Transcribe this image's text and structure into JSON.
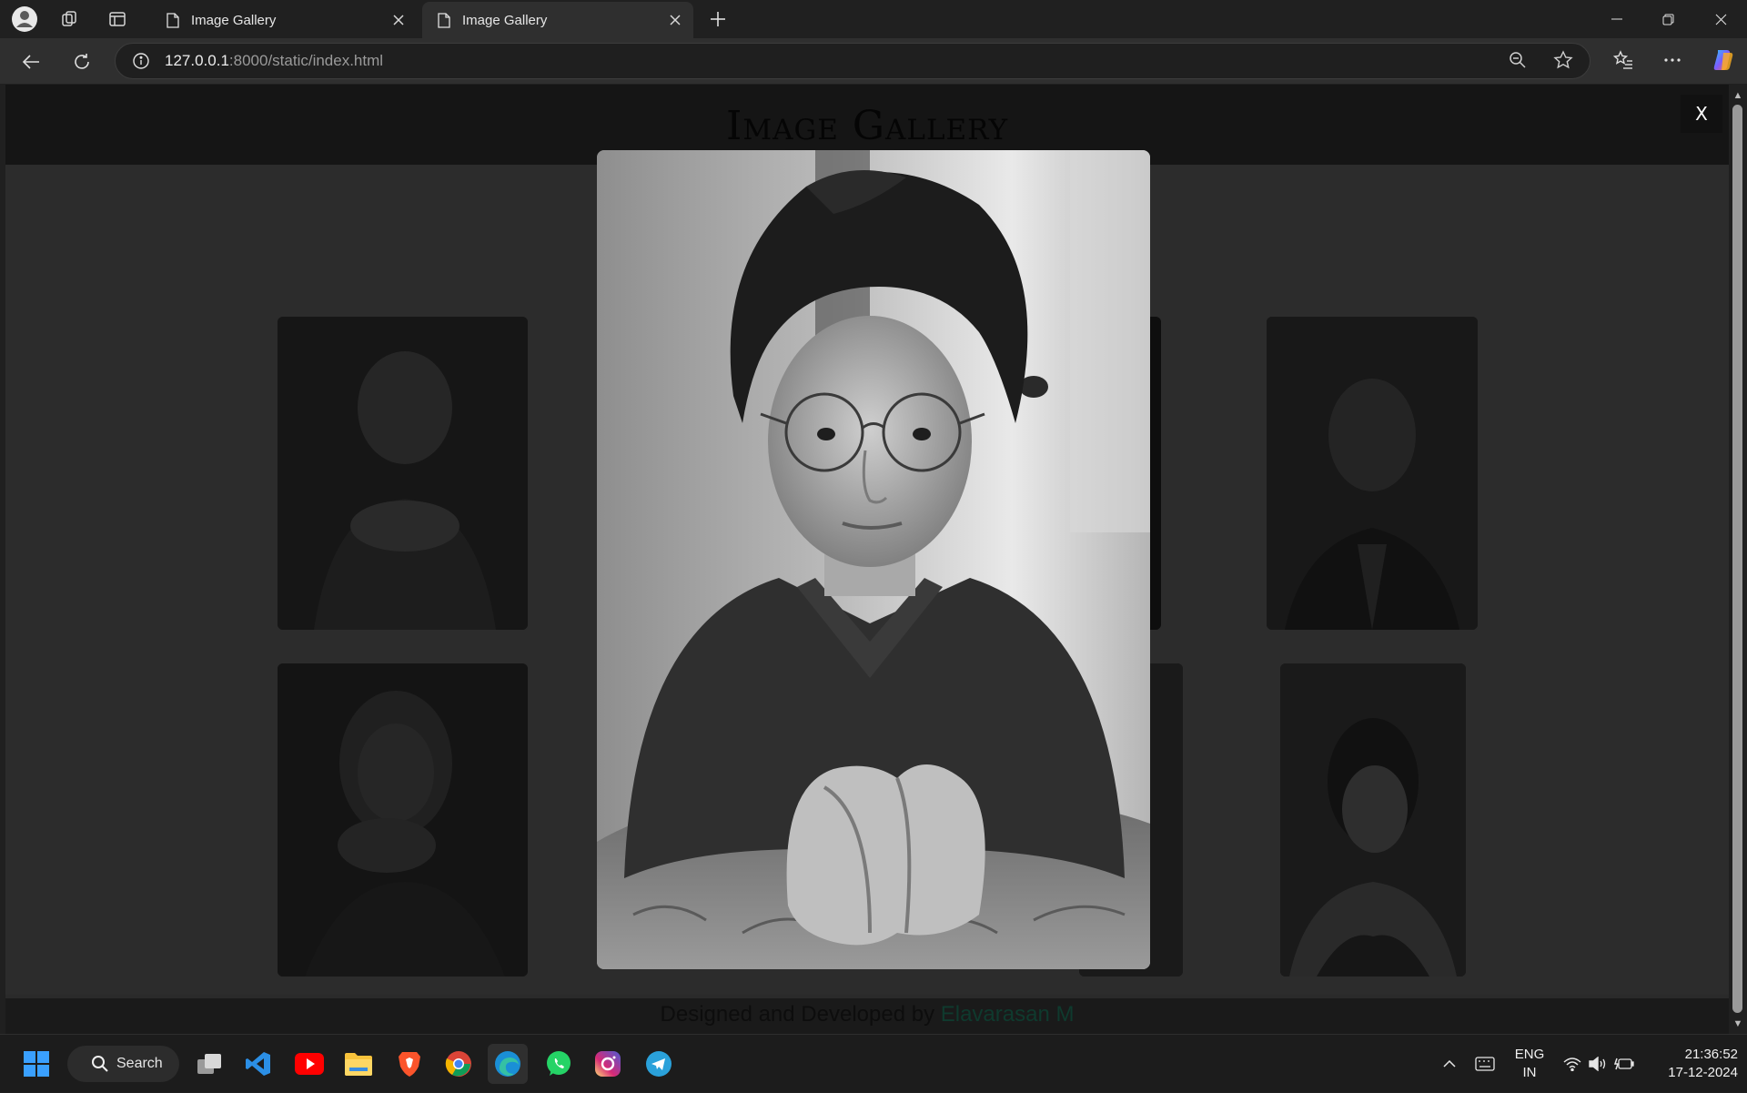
{
  "browser": {
    "tabs": [
      {
        "title": "Image Gallery",
        "active": false
      },
      {
        "title": "Image Gallery",
        "active": true
      }
    ],
    "url_host": "127.0.0.1",
    "url_rest": ":8000/static/index.html"
  },
  "page": {
    "title": "Image Gallery",
    "footer_prefix": "Designed and Developed by ",
    "footer_author": "Elavarasan M",
    "modal_close_label": "X"
  },
  "taskbar": {
    "search_label": "Search",
    "lang_top": "ENG",
    "lang_bottom": "IN",
    "time": "21:36:52",
    "date": "17-12-2024"
  },
  "colors": {
    "accent_author": "#0f3a2e",
    "overlay": "#2c2c2c"
  }
}
